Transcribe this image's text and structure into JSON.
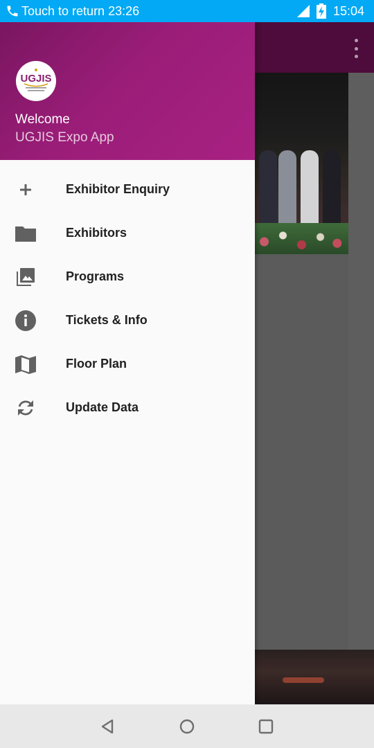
{
  "status_bar": {
    "call_text": "Touch to return 23:26",
    "clock": "15:04",
    "icons": [
      "phone-icon",
      "signal-icon",
      "battery-charging-icon"
    ],
    "background_color": "#03a9f4"
  },
  "drawer": {
    "header": {
      "logo_text": "UGJIS",
      "welcome": "Welcome",
      "app_name": "UGJIS Expo App",
      "gradient_colors": [
        "#7a1660",
        "#a82182"
      ]
    },
    "items": [
      {
        "label": "Exhibitor Enquiry",
        "icon": "plus-icon"
      },
      {
        "label": "Exhibitors",
        "icon": "folder-icon"
      },
      {
        "label": "Programs",
        "icon": "photo-library-icon"
      },
      {
        "label": "Tickets & Info",
        "icon": "info-icon"
      },
      {
        "label": "Floor Plan",
        "icon": "map-icon"
      },
      {
        "label": "Update Data",
        "icon": "refresh-icon"
      }
    ]
  },
  "nav_bar": {
    "buttons": [
      "back-icon",
      "home-icon",
      "recent-apps-icon"
    ]
  }
}
